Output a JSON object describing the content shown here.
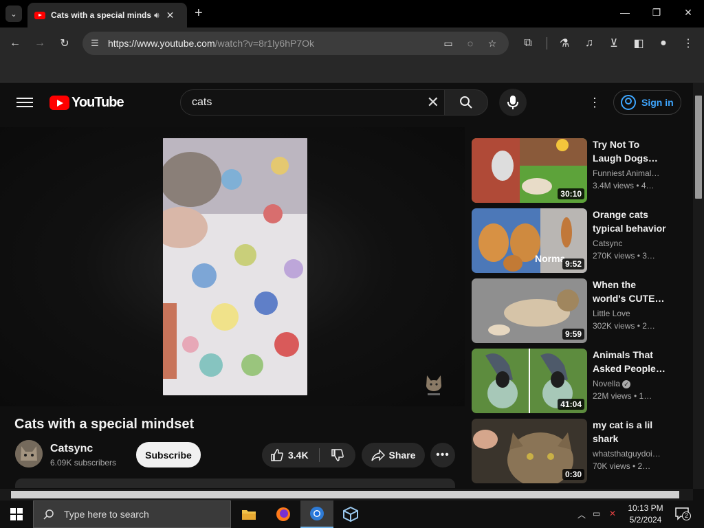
{
  "browser": {
    "tab_title": "Cats with a special mindset",
    "url_host": "https://www.youtube.com",
    "url_path": "/watch?v=8r1ly6hP7Ok"
  },
  "youtube": {
    "logo_text": "YouTube",
    "search_value": "cats",
    "sign_in": "Sign in"
  },
  "video": {
    "title": "Cats with a special mindset",
    "channel": "Catsync",
    "subscribers": "6.09K subscribers",
    "subscribe_label": "Subscribe",
    "likes": "3.4K",
    "share_label": "Share"
  },
  "recommendations": [
    {
      "title": "Try Not To Laugh Dogs…",
      "channel": "Funniest Animal…",
      "meta": "3.4M views  • 4…",
      "duration": "30:10",
      "verified": false
    },
    {
      "title": "Orange cats typical behavior",
      "channel": "Catsync",
      "meta": "270K views  • 3…",
      "duration": "9:52",
      "verified": false
    },
    {
      "title": "When the world's CUTE…",
      "channel": "Little Love",
      "meta": "302K views  • 2…",
      "duration": "9:59",
      "verified": false
    },
    {
      "title": "Animals That Asked People…",
      "channel": "Novella",
      "meta": "22M views  • 1…",
      "duration": "41:04",
      "verified": true
    },
    {
      "title": "my cat is a lil shark",
      "channel": "whatsthatguydoi…",
      "meta": "70K views  • 2…",
      "duration": "0:30",
      "verified": false
    }
  ],
  "thumb_overlay_text": "Norma",
  "taskbar": {
    "search_placeholder": "Type here to search",
    "time": "10:13 PM",
    "date": "5/2/2024",
    "notifications": "2"
  },
  "colors": {
    "accent_blue": "#3ea6ff",
    "youtube_red": "#ff0000",
    "background": "#0f0f0f"
  }
}
